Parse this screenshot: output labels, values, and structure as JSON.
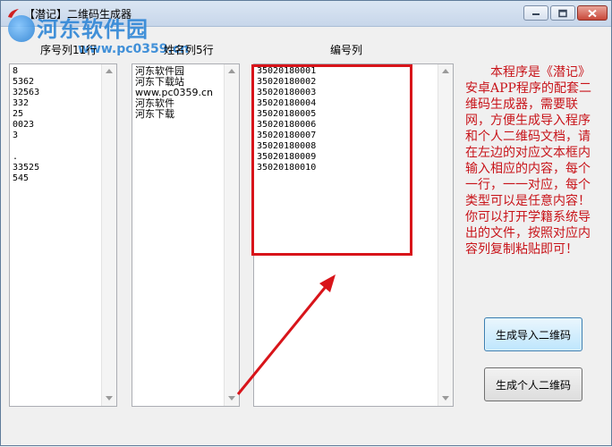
{
  "window": {
    "title": "【潜记】二维码生成器",
    "watermark_title": "河东软件园",
    "watermark_url": "www.pc0359.cn"
  },
  "columns": {
    "id_label": "序号列11行",
    "name_label": "姓名列5行",
    "code_label": "编号列"
  },
  "id_list": [
    "8",
    "5362",
    "32563",
    "332",
    "25",
    "0023",
    "3",
    "",
    ".",
    "33525",
    "545"
  ],
  "name_list": [
    "河东软件园",
    "河东下载站",
    "www.pc0359.cn",
    "河东软件",
    "河东下载"
  ],
  "code_list": [
    "35020180001",
    "35020180002",
    "35020180003",
    "35020180004",
    "35020180005",
    "35020180006",
    "35020180007",
    "35020180008",
    "35020180009",
    "35020180010"
  ],
  "description": "本程序是《潜记》安卓APP程序的配套二维码生成器，需要联网，方便生成导入程序和个人二维码文档，请在左边的对应文本框内输入相应的内容，每个一行，一一对应，每个类型可以是任意内容！你可以打开学籍系统导出的文件，按照对应内容列复制粘贴即可！",
  "buttons": {
    "import_qr": "生成导入二维码",
    "personal_qr": "生成个人二维码"
  },
  "colors": {
    "annotation_red": "#d8141a",
    "description_red": "#c8141a",
    "watermark_blue": "#2f86d6"
  }
}
